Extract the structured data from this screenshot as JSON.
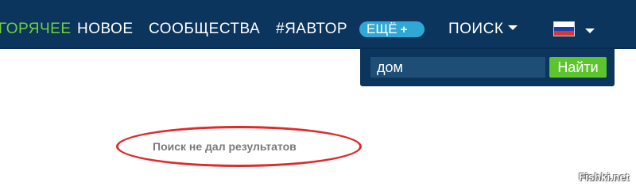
{
  "nav": {
    "hot": "ГОРЯЧЕЕ",
    "new": "НОВОЕ",
    "communities": "СООБЩЕСТВА",
    "author": "#ЯАВТОР",
    "more": "ЕЩЁ",
    "more_plus": "+",
    "search": "ПОИСК"
  },
  "language": {
    "flag_colors": [
      "#ffffff",
      "#1c3fae",
      "#e0352b"
    ],
    "icon": "russian-flag-icon"
  },
  "search": {
    "query": "дом",
    "button_label": "Найти"
  },
  "results": {
    "message": "Поиск не дал результатов"
  },
  "watermark": "Fishki.net",
  "colors": {
    "navbar": "#0b355c",
    "hot": "#6dd13d",
    "more_pill": "#2fa8d6",
    "search_button": "#5cc52e",
    "highlight": "#e02a2a"
  }
}
